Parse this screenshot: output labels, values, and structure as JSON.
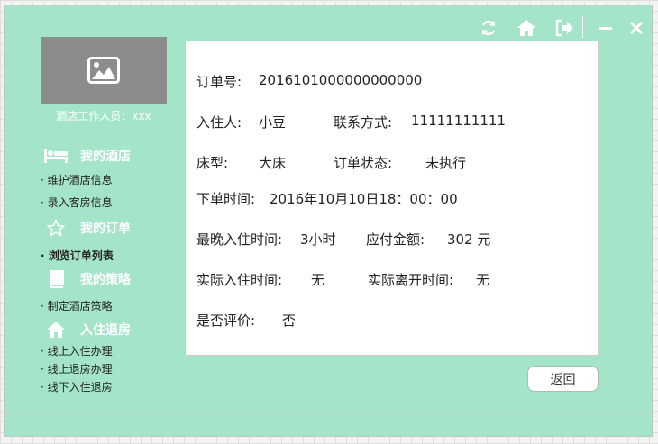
{
  "topbar": {
    "icons": [
      "refresh-icon",
      "home-icon",
      "logout-icon",
      "minimize-icon",
      "close-icon"
    ]
  },
  "sidebar": {
    "staff_label": "酒店工作人员：xxx",
    "categories": [
      {
        "label": "我的酒店",
        "icon": "bed-icon"
      },
      {
        "label": "我的订单",
        "icon": "star-icon"
      },
      {
        "label": "我的策略",
        "icon": "book-icon"
      },
      {
        "label": "入住退房",
        "icon": "home-icon"
      }
    ],
    "items": [
      "· 维护酒店信息",
      "· 录入客房信息",
      "· 浏览订单列表",
      "· 制定酒店策略",
      "· 线上入住办理",
      "· 线上退房办理",
      "· 线下入住退房"
    ]
  },
  "order": {
    "order_no_label": "订单号:",
    "order_no_value": "2016101000000000000",
    "guest_label": "入住人:",
    "guest_value": "小豆",
    "contact_label": "联系方式:",
    "contact_value": "11111111111",
    "bed_label": "床型:",
    "bed_value": "大床",
    "status_label": "订单状态:",
    "status_value": "未执行",
    "order_time_label": "下单时间:",
    "order_time_value": "2016年10月10日18：00：00",
    "latest_checkin_label": "最晚入住时间:",
    "latest_checkin_value": "3小时",
    "amount_label": "应付金额:",
    "amount_value": "302 元",
    "actual_checkin_label": "实际入住时间:",
    "actual_checkin_value": "无",
    "actual_checkout_label": "实际离开时间:",
    "actual_checkout_value": "无",
    "reviewed_label": "是否评价:",
    "reviewed_value": "否"
  },
  "buttons": {
    "back": "返回"
  },
  "colors": {
    "window_bg": "#a4e5c9",
    "avatar_bg": "#8c8c8c",
    "panel_bg": "#ffffff"
  }
}
